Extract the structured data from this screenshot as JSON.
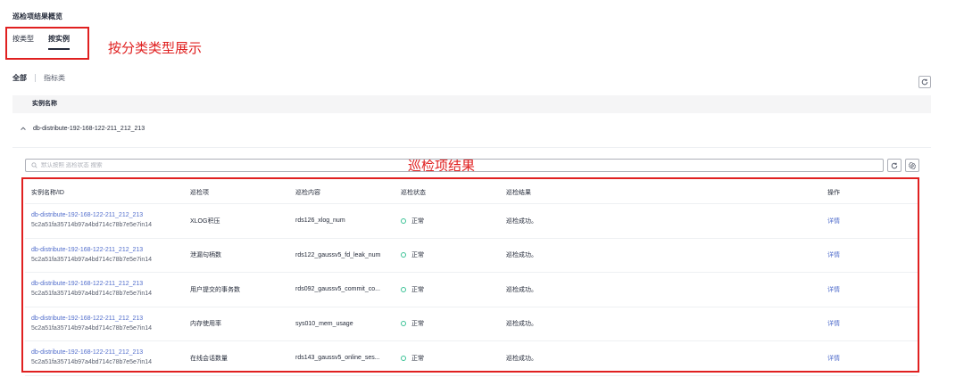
{
  "page_title": "巡检项结果概览",
  "type_tabs": [
    {
      "label": "按类型",
      "active": false
    },
    {
      "label": "按实例",
      "active": true
    }
  ],
  "annotations": {
    "type_display": "按分类类型展示",
    "results": "巡检项结果"
  },
  "filter": {
    "all": "全部",
    "metric": "指标类"
  },
  "group_header": "实例名称",
  "instance_group": "db-distribute-192-168-122-211_212_213",
  "search": {
    "placeholder": "默认按照 巡检状态 搜索"
  },
  "table": {
    "headers": [
      "实例名称/ID",
      "巡检项",
      "巡检内容",
      "巡检状态",
      "巡检结果",
      "操作"
    ],
    "rows": [
      {
        "name": "db-distribute-192-168-122-211_212_213",
        "id": "5c2a51fa35714b97a4bd714c78b7e5e7in14",
        "item": "XLOG积压",
        "content": "rds126_xlog_num",
        "status": "正常",
        "result": "巡检成功。",
        "action": "详情"
      },
      {
        "name": "db-distribute-192-168-122-211_212_213",
        "id": "5c2a51fa35714b97a4bd714c78b7e5e7in14",
        "item": "泄漏句柄数",
        "content": "rds122_gaussv5_fd_leak_num",
        "status": "正常",
        "result": "巡检成功。",
        "action": "详情"
      },
      {
        "name": "db-distribute-192-168-122-211_212_213",
        "id": "5c2a51fa35714b97a4bd714c78b7e5e7in14",
        "item": "用户提交的事务数",
        "content": "rds092_gaussv5_commit_co...",
        "status": "正常",
        "result": "巡检成功。",
        "action": "详情"
      },
      {
        "name": "db-distribute-192-168-122-211_212_213",
        "id": "5c2a51fa35714b97a4bd714c78b7e5e7in14",
        "item": "内存使用率",
        "content": "sys010_mem_usage",
        "status": "正常",
        "result": "巡检成功。",
        "action": "详情"
      },
      {
        "name": "db-distribute-192-168-122-211_212_213",
        "id": "5c2a51fa35714b97a4bd714c78b7e5e7in14",
        "item": "在线会话数量",
        "content": "rds143_gaussv5_online_ses...",
        "status": "正常",
        "result": "巡检成功。",
        "action": "详情"
      }
    ]
  },
  "icons": {
    "refresh": "refresh-icon",
    "settings": "settings-icon",
    "search": "search-icon",
    "collapse": "chevron-up-icon"
  },
  "colors": {
    "link": "#526ecc",
    "status_normal": "#3ac295",
    "annotation": "#e02020"
  }
}
